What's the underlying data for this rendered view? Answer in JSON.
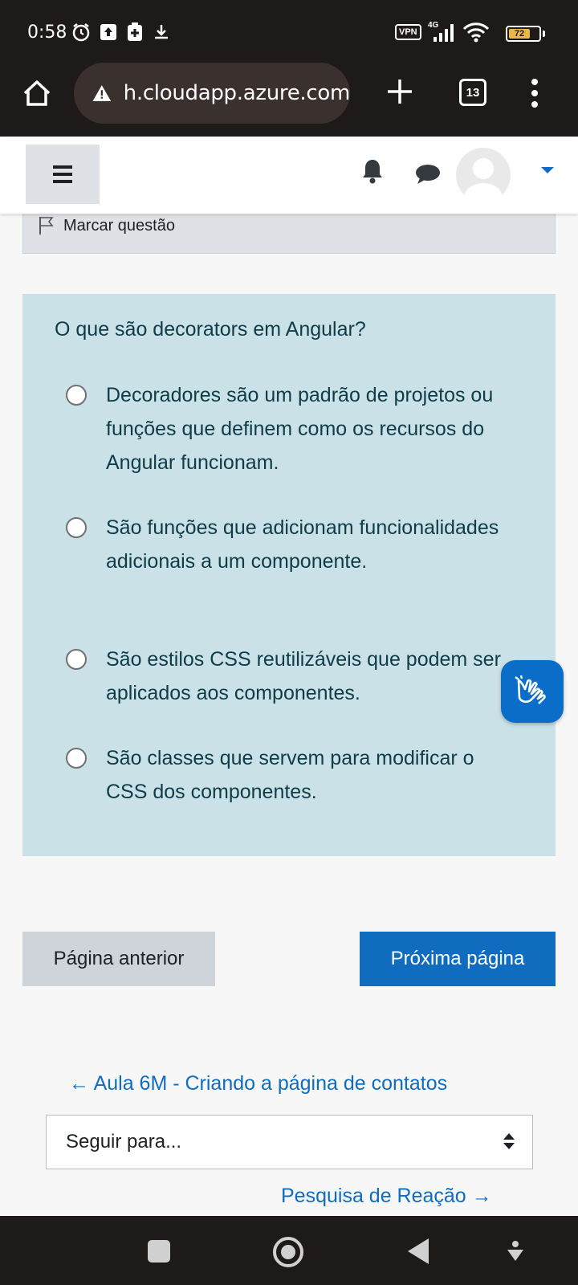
{
  "status_bar": {
    "time": "0:58",
    "vpn": "VPN",
    "network": "4G",
    "battery": "72",
    "battery_level": 0.72,
    "icons": [
      "alarm-icon",
      "upload-icon",
      "battery-saver-icon",
      "download-icon",
      "signal-icon",
      "wifi-icon"
    ]
  },
  "browser": {
    "url": "h.cloudapp.azure.com",
    "tab_count": "13",
    "icons": [
      "home-icon",
      "warning-icon",
      "plus-icon",
      "menu-dots-icon"
    ]
  },
  "header": {
    "icons": [
      "hamburger-icon",
      "bell-icon",
      "chat-icon",
      "avatar-icon",
      "caret-down-icon"
    ]
  },
  "flag": {
    "label": "Marcar questão"
  },
  "question": {
    "text": "O que são decorators em Angular?",
    "options": [
      {
        "label": "Decoradores são um padrão de projetos ou funções que definem como os recursos do Angular funcionam.",
        "selected": false
      },
      {
        "label": "São funções que adicionam funcionalidades adicionais a um componente.",
        "selected": false
      },
      {
        "label": "São estilos CSS reutilizáveis que podem ser aplicados aos componentes.",
        "selected": false
      },
      {
        "label": "São classes que servem para modificar o CSS dos componentes.",
        "selected": false
      }
    ]
  },
  "navigation": {
    "prev_label": "Página anterior",
    "next_label": "Próxima página",
    "prev_activity": "← Aula 6M - Criando a página de contatos",
    "jump_placeholder": "Seguir para...",
    "next_activity": "Pesquisa de Reação →"
  },
  "colors": {
    "primary": "#0f6cbf",
    "question_bg": "#c9e1e7",
    "browser_bg": "#1e1a19"
  }
}
